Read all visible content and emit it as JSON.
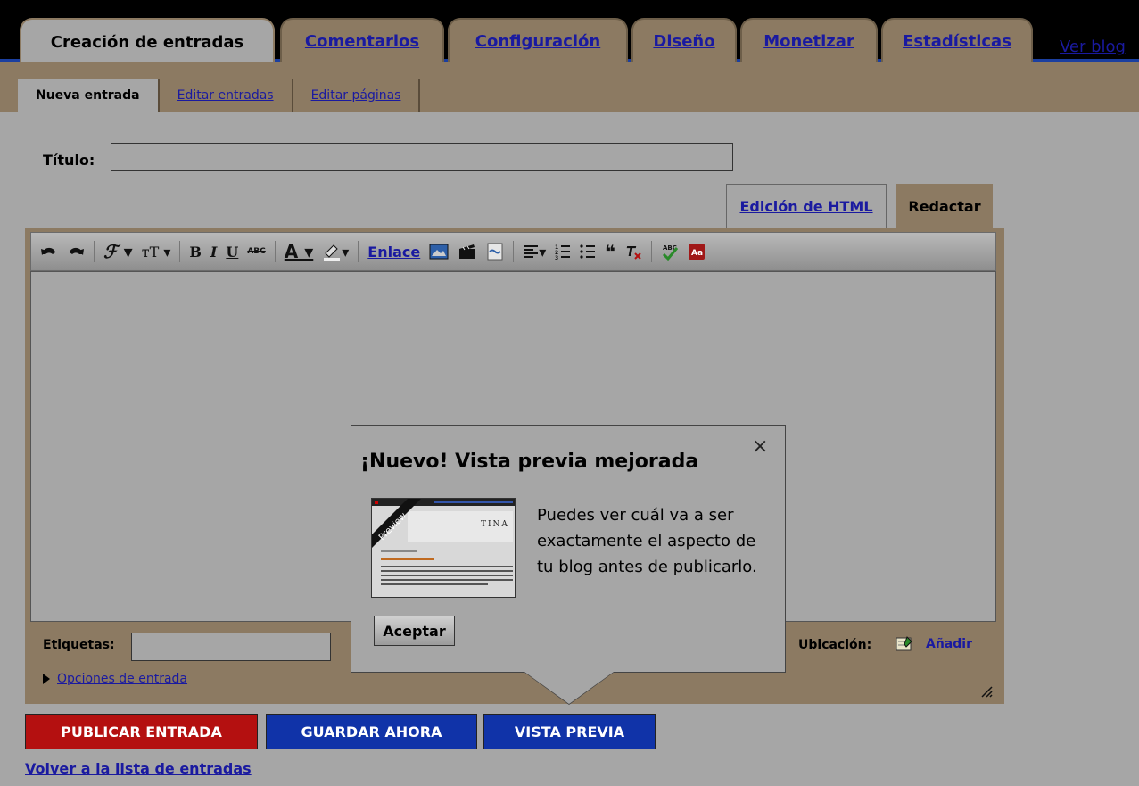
{
  "main_tabs": [
    {
      "label": "Creación de entradas",
      "active": true
    },
    {
      "label": "Comentarios"
    },
    {
      "label": "Configuración"
    },
    {
      "label": "Diseño"
    },
    {
      "label": "Monetizar"
    },
    {
      "label": "Estadísticas"
    }
  ],
  "view_blog_link": "Ver blog",
  "sub_tabs": [
    {
      "label": "Nueva entrada",
      "active": true
    },
    {
      "label": "Editar entradas"
    },
    {
      "label": "Editar páginas"
    }
  ],
  "title_field": {
    "label": "Título:",
    "value": ""
  },
  "editor_modes": {
    "html": "Edición de HTML",
    "compose": "Redactar"
  },
  "toolbar": {
    "bold": "B",
    "italic": "I",
    "underline": "U",
    "strike": "ABC",
    "link": "Enlace"
  },
  "labels_field": {
    "label": "Etiquetas:",
    "value": ""
  },
  "post_options": "Opciones de entrada",
  "location": {
    "label": "Ubicación:",
    "link": "Añadir"
  },
  "buttons": {
    "publish": "PUBLICAR ENTRADA",
    "save": "GUARDAR AHORA",
    "preview": "VISTA PREVIA"
  },
  "back_link": "Volver a la lista de entradas",
  "popup": {
    "title": "¡Nuevo! Vista previa mejorada",
    "close": "×",
    "body": "Puedes ver cuál va a ser exactamente el aspecto de tu blog antes de publicarlo.",
    "button": "Aceptar",
    "thumb_badge": "Preview",
    "thumb_heading": "TINA"
  },
  "colors": {
    "background": "#a6a6a6",
    "tab_brown": "#8c7a62",
    "publish_red": "#b41010",
    "button_blue": "#1033a8",
    "link_blue": "#1a1aa0"
  }
}
